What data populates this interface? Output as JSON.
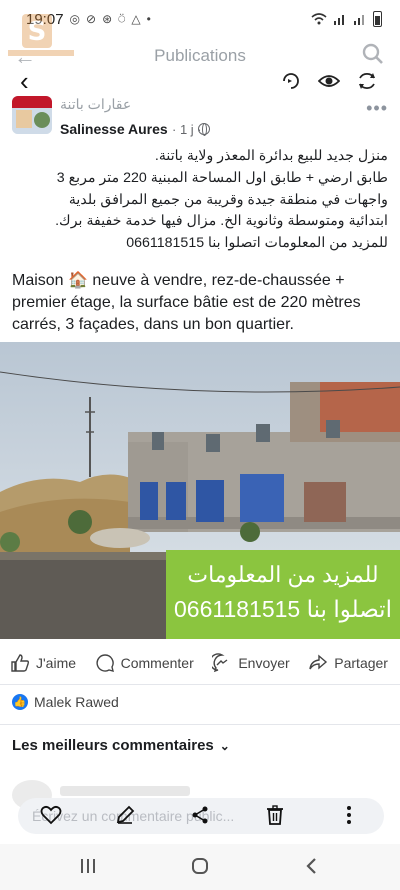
{
  "status": {
    "time": "19:07",
    "battery_level": 0.75
  },
  "nav": {
    "title": "Publications"
  },
  "post": {
    "page_name": "عقارات باتنة",
    "author": "Salinesse Aures",
    "meta": "· 1 j ·",
    "text_ar": [
      "منزل جديد للبيع بدائرة المعذر ولاية باتنة.",
      "طابق ارضي + طابق اول المساحة المبنية 220 متر مربع 3",
      "واجهات في منطقة جيدة وقريبة من جميع المرافق بلدية",
      "ابتدائية ومتوسطة وثانوية الخ. مزال فيها خدمة خفيفة برك.",
      "للمزيد من المعلومات اتصلوا بنا 0661181515"
    ],
    "text_fr": "Maison 🏠 neuve à vendre, rez-de-chaussée + premier étage, la surface bâtie est de 220 mètres carrés, 3 façades, dans un bon quartier.",
    "promo_line1": "للمزيد من المعلومات",
    "promo_line2": "اتصلوا بنا 0661181515"
  },
  "actions": {
    "like": "J'aime",
    "comment": "Commenter",
    "send": "Envoyer",
    "share": "Partager"
  },
  "reactions": {
    "name": "Malek Rawed"
  },
  "comments": {
    "header": "Les meilleurs commentaires",
    "input_placeholder": "Écrivez un commentaire public..."
  },
  "colors": {
    "promo": "#8bc53f",
    "facebook_blue": "#1877f2"
  }
}
